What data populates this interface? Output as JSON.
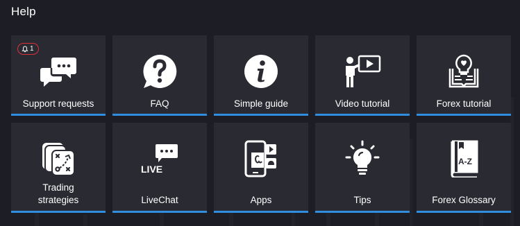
{
  "header": {
    "title": "Help"
  },
  "colors": {
    "accent": "#2f8ee0",
    "badge": "#e0303a",
    "tile": "#2a2a33",
    "background": "#1d1d25"
  },
  "tiles": [
    {
      "label": "Support requests",
      "icon": "chat-bubbles-icon",
      "badge": "1"
    },
    {
      "label": "FAQ",
      "icon": "question-bubble-icon"
    },
    {
      "label": "Simple guide",
      "icon": "info-icon"
    },
    {
      "label": "Video tutorial",
      "icon": "presenter-video-icon"
    },
    {
      "label": "Forex tutorial",
      "icon": "lightbulb-book-icon"
    },
    {
      "label": "Trading strategies",
      "icon": "strategy-cards-icon"
    },
    {
      "label": "LiveChat",
      "icon": "livechat-icon",
      "icon_text": "LIVE"
    },
    {
      "label": "Apps",
      "icon": "mobile-apps-icon"
    },
    {
      "label": "Tips",
      "icon": "tips-bulb-icon"
    },
    {
      "label": "Forex Glossary",
      "icon": "glossary-book-icon",
      "icon_text": "A-Z"
    }
  ]
}
